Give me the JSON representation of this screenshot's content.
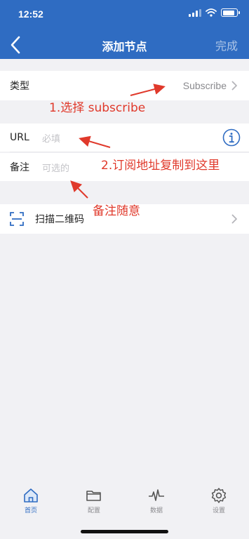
{
  "status_bar": {
    "time": "12:52",
    "battery_level": 0.85
  },
  "nav": {
    "title": "添加节点",
    "done_label": "完成"
  },
  "type_row": {
    "label": "类型",
    "value": "Subscribe"
  },
  "url_row": {
    "label": "URL",
    "placeholder": "必填"
  },
  "note_row": {
    "label": "备注",
    "placeholder": "可选的"
  },
  "scan_row": {
    "label": "扫描二维码"
  },
  "annotations": {
    "step1": "1.选择 subscribe",
    "step2": "2.订阅地址复制到这里",
    "note_hint": "备注随意"
  },
  "tabs": [
    {
      "label": "首页",
      "icon": "home-icon",
      "active": true
    },
    {
      "label": "配置",
      "icon": "folder-icon",
      "active": false
    },
    {
      "label": "数据",
      "icon": "activity-icon",
      "active": false
    },
    {
      "label": "设置",
      "icon": "gear-icon",
      "active": false
    }
  ],
  "colors": {
    "accent": "#2f6cc2",
    "annotation": "#e0392b"
  }
}
